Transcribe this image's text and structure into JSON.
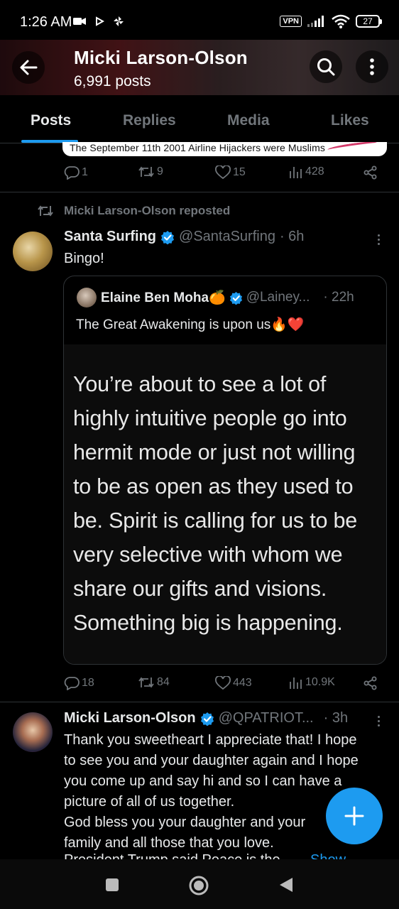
{
  "status_bar": {
    "time": "1:26 AM",
    "vpn": "VPN",
    "battery": "27"
  },
  "header": {
    "title": "Micki Larson-Olson",
    "subtitle": "6,991 posts"
  },
  "tabs": [
    {
      "label": "Posts",
      "active": true
    },
    {
      "label": "Replies",
      "active": false
    },
    {
      "label": "Media",
      "active": false
    },
    {
      "label": "Likes",
      "active": false
    }
  ],
  "prev_post": {
    "image_text": "The September 11th 2001 Airline Hijackers were Muslims",
    "replies": "1",
    "reposts": "9",
    "likes": "15",
    "views": "428"
  },
  "repost_post": {
    "repost_label": "Micki Larson-Olson reposted",
    "name": "Santa Surfing",
    "handle": "@SantaSurfing",
    "time": "· 6h",
    "text": "Bingo!",
    "quote": {
      "name": "Elaine Ben Moha🍊",
      "handle": "@Lainey...",
      "time": "· 22h",
      "text": "The Great Awakening is upon us🔥❤️",
      "image_text": "You’re about to see a lot of\nhighly intuitive people go into\nhermit mode or just not willing\nto be as open as they used to\nbe. Spirit is calling for us to be\nvery selective with whom we\nshare our gifts and visions.\nSomething big is happening."
    },
    "replies": "18",
    "reposts": "84",
    "likes": "443",
    "views": "10.9K"
  },
  "reply_post": {
    "name": "Micki Larson-Olson",
    "handle": "@QPATRIOT...",
    "time": "· 3h",
    "text": "Thank you sweetheart I appreciate that! I hope\nto see you and your daughter again and I hope\nyou come up and say hi and so I can have a\npicture of all of us together.\nGod bless you your daughter and your\nfamily and all those that you love.",
    "cut_text": "President Trump said Peace is the",
    "show_more": "Show"
  },
  "colors": {
    "accent": "#1d9bf0",
    "muted": "#71767b",
    "text": "#e7e9ea",
    "divider": "#2f3336"
  }
}
